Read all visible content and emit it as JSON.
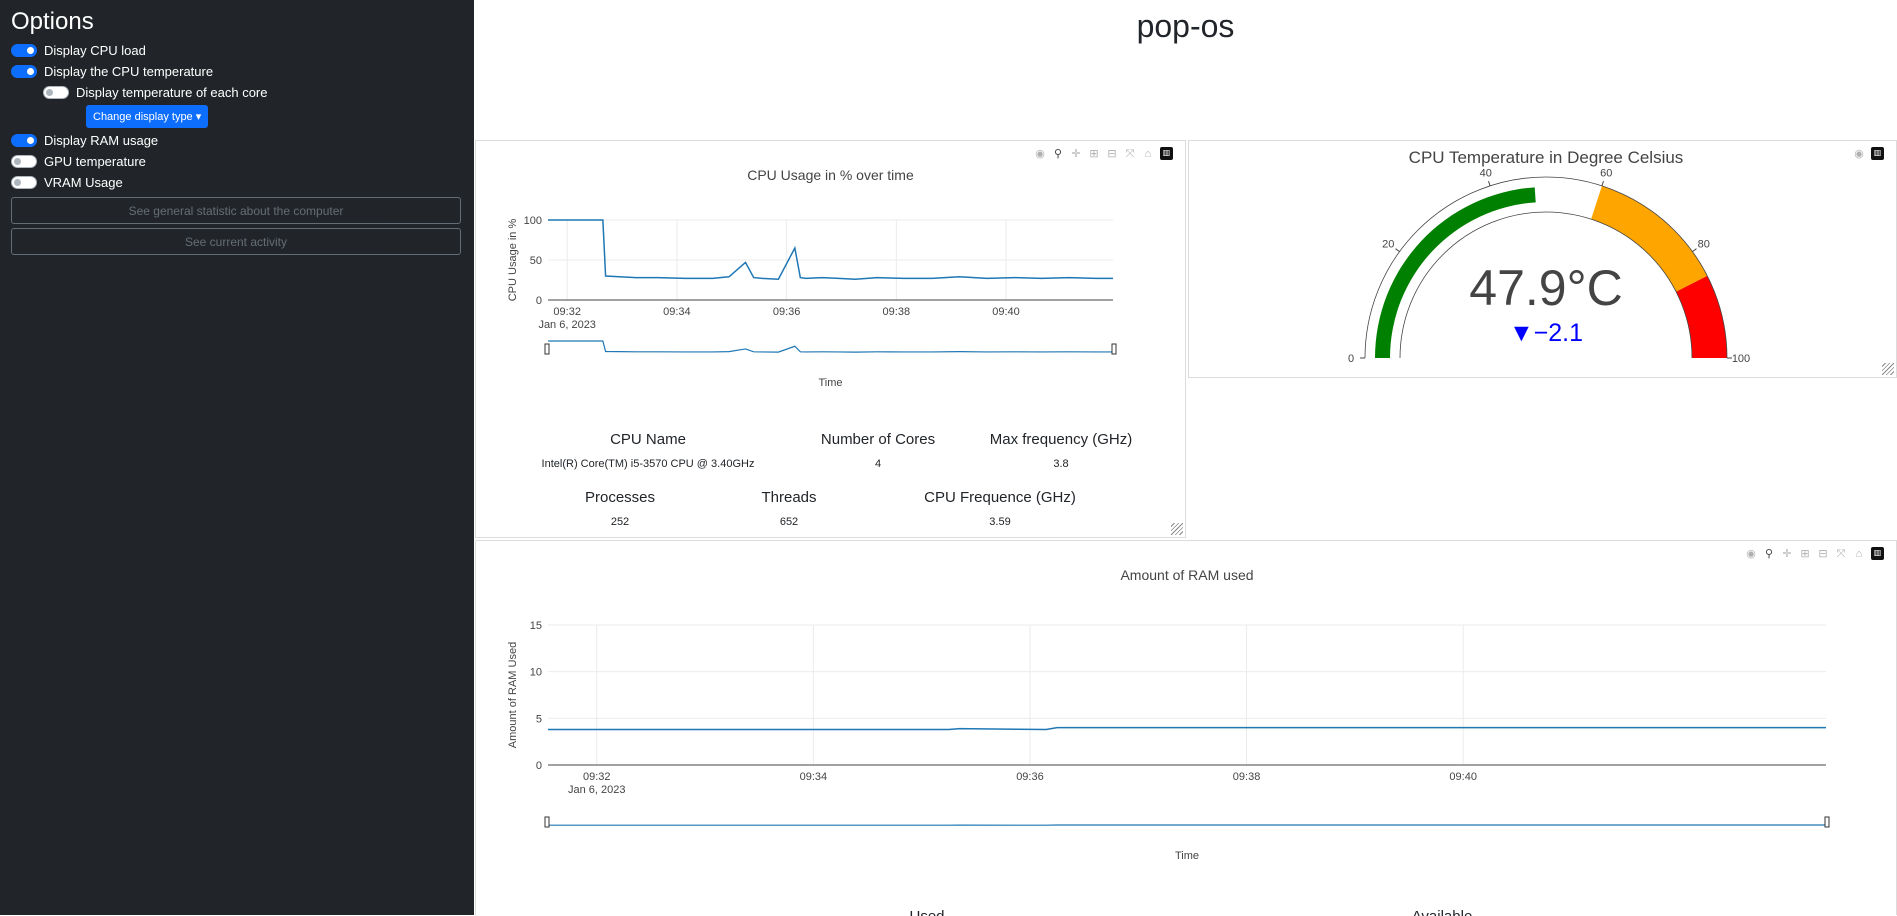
{
  "sidebar": {
    "title": "Options",
    "options": [
      {
        "label": "Display CPU load",
        "on": true
      },
      {
        "label": "Display the CPU temperature",
        "on": true
      },
      {
        "label": "Display temperature of each core",
        "on": false
      },
      {
        "label": "Display RAM usage",
        "on": true
      },
      {
        "label": "GPU temperature",
        "on": false
      },
      {
        "label": "VRAM Usage",
        "on": false
      }
    ],
    "display_type_button": "Change display type ▾",
    "general_stats_button": "See general statistic about the computer",
    "current_activity_button": "See current activity"
  },
  "hostname": "pop-os",
  "cpu_info": {
    "headers": [
      "CPU Name",
      "Number of Cores",
      "Max frequency (GHz)",
      "Processes",
      "Threads",
      "CPU Frequence (GHz)"
    ],
    "values": [
      "Intel(R) Core(TM) i5-3570 CPU @ 3.40GHz",
      "4",
      "3.8",
      "252",
      "652",
      "3.59"
    ]
  },
  "colors": {
    "line": "#1f77b4",
    "gauge_green": "#008000",
    "gauge_orange": "#FFA500",
    "gauge_red": "#FF0000",
    "delta": "#0000FF"
  },
  "chart_data": [
    {
      "type": "line",
      "title": "CPU Usage in % over time",
      "xlabel": "Time",
      "ylabel": "CPU Usage in %",
      "x_ticks": [
        "09:32",
        "09:34",
        "09:36",
        "09:38",
        "09:40"
      ],
      "x_sublabel": "Jan 6, 2023",
      "y_ticks": [
        "0",
        "50",
        "100"
      ],
      "ylim": [
        0,
        100
      ],
      "x_minutes": [
        0,
        0.5,
        1.0,
        1.05,
        1.3,
        1.6,
        2.0,
        2.5,
        3.0,
        3.3,
        3.6,
        3.75,
        3.9,
        4.2,
        4.5,
        4.6,
        4.7,
        5.0,
        5.3,
        5.6,
        6.0,
        6.5,
        7.0,
        7.5,
        8.0,
        8.5,
        9.0,
        9.5,
        10.0,
        10.3
      ],
      "values": [
        100,
        100,
        100,
        30,
        29,
        28,
        28,
        27,
        27,
        29,
        47,
        28,
        27,
        26,
        65,
        28,
        27,
        28,
        27,
        26,
        28,
        27,
        27,
        29,
        27,
        28,
        27,
        28,
        27,
        27
      ]
    },
    {
      "type": "gauge",
      "title": "CPU Temperature in Degree Celsius",
      "value_text": "47.9°C",
      "value": 47.9,
      "delta_text": "▼−2.1",
      "range": [
        0,
        100
      ],
      "ticks": [
        "0",
        "20",
        "40",
        "60",
        "80",
        "100"
      ],
      "steps": [
        {
          "from": 60,
          "to": 85,
          "color": "orange"
        },
        {
          "from": 85,
          "to": 100,
          "color": "red"
        }
      ]
    },
    {
      "type": "line",
      "title": "Amount of RAM used",
      "xlabel": "Time",
      "ylabel": "Amount of RAM Used",
      "x_ticks": [
        "09:32",
        "09:34",
        "09:36",
        "09:38",
        "09:40"
      ],
      "x_sublabel": "Jan 6, 2023",
      "y_ticks": [
        "0",
        "5",
        "10",
        "15"
      ],
      "ylim": [
        0,
        15
      ],
      "x_minutes": [
        0,
        1,
        2,
        3,
        3.7,
        3.8,
        4.6,
        4.7,
        6,
        7,
        8,
        9,
        10,
        11,
        11.8
      ],
      "values": [
        3.8,
        3.8,
        3.8,
        3.8,
        3.8,
        3.9,
        3.8,
        4.0,
        4.0,
        4.0,
        4.0,
        4.0,
        4.0,
        4.0,
        4.0
      ]
    }
  ],
  "bottom_headers": [
    "Used",
    "Available"
  ]
}
